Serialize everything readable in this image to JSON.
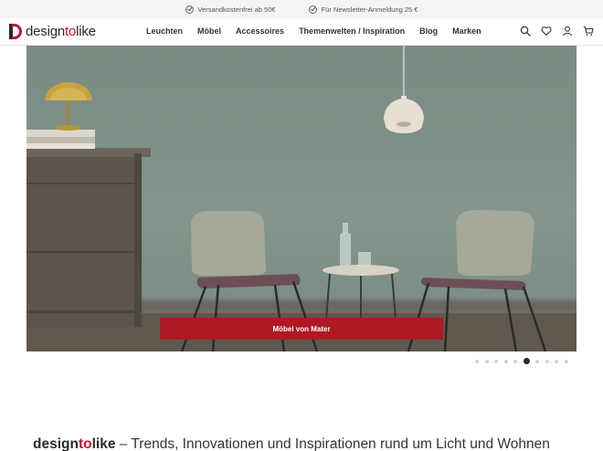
{
  "topbar": {
    "usps": [
      "Versandkostenfrei ab 50€",
      "Für Newsletter-Anmeldung 25 €"
    ]
  },
  "header": {
    "logo": {
      "part1": "design",
      "part2": "to",
      "part3": "like"
    },
    "nav": [
      "Leuchten",
      "Möbel",
      "Accessoires",
      "Themenwelten / Inspiration",
      "Blog",
      "Marken"
    ],
    "icons": [
      "search-icon",
      "heart-icon",
      "user-icon",
      "cart-icon"
    ]
  },
  "hero": {
    "cta_label": "Möbel von Mater",
    "slides_count": 10,
    "active_slide": 6
  },
  "tagline": {
    "brand1": "design",
    "brand2": "to",
    "brand3": "like",
    "text": " – Trends, Innovationen und Inspirationen rund um Licht und Wohnen"
  },
  "colors": {
    "accent": "#c8102e",
    "cta": "#b01823",
    "wall": "#82948b"
  }
}
